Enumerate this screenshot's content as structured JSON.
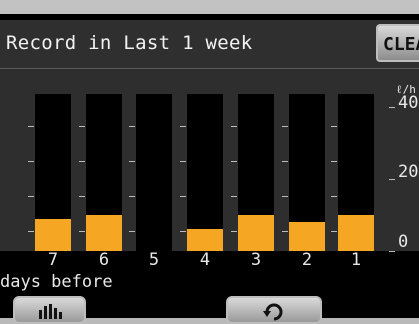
{
  "screen": {
    "title": "Record in Last 1 week",
    "clear_label": "CLEAR",
    "unit": "ℓ/h",
    "footer_label": "days before"
  },
  "chart_data": {
    "type": "bar",
    "categories": [
      "7",
      "6",
      "5",
      "4",
      "3",
      "2",
      "1"
    ],
    "values": [
      9,
      10,
      0,
      6,
      10,
      8,
      10
    ],
    "xlabel": "days before",
    "ylabel": "ℓ/h",
    "ylim": [
      0,
      40
    ],
    "yticks": [
      "40",
      "20",
      "0"
    ],
    "colors": {
      "bar": "#f5a623",
      "column": "#000000",
      "plot_background": "#2e2e2e"
    }
  },
  "buttons": {
    "graph_icon": "bar-graph-icon",
    "back_icon": "return-arrow-icon"
  }
}
